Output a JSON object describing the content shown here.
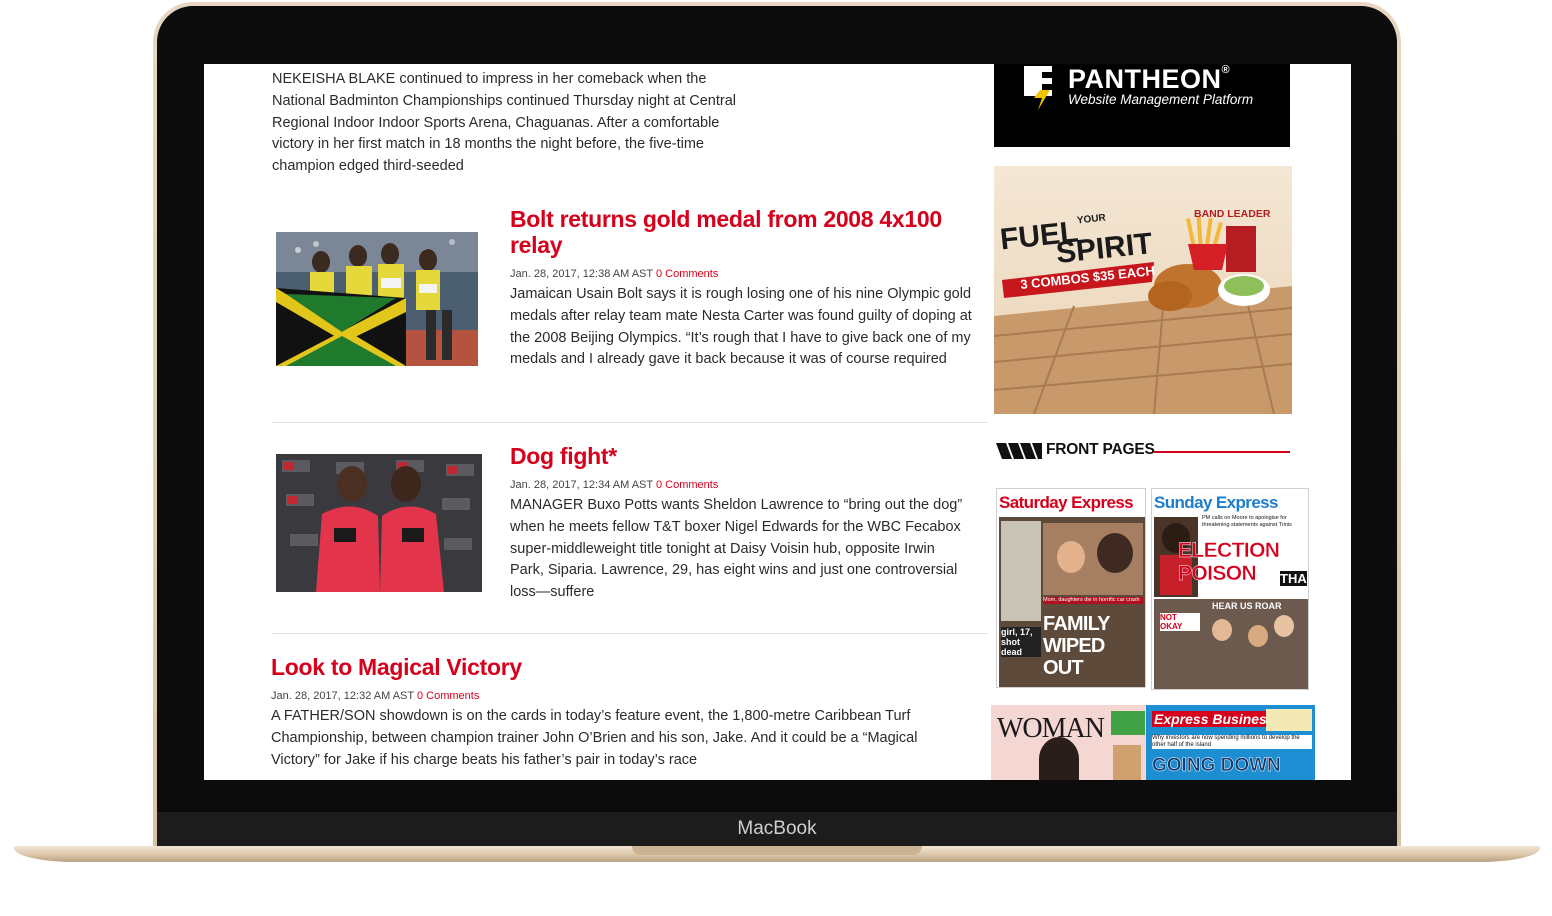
{
  "device": {
    "brand": "MacBook"
  },
  "lead_article": {
    "text": "NEKEISHA BLAKE continued to impress in her comeback when the National Badminton Championships continued Thursday night at Central Regional Indoor Indoor Sports Arena, Chaguanas. After a comfortable victory in her first match in 18 months the night before, the five-time champion edged third-seeded"
  },
  "articles": [
    {
      "headline": "Bolt returns gold medal from 2008 4x100 relay",
      "date": "Jan. 28, 2017, 12:38 AM AST",
      "comments": "0 Comments",
      "excerpt": "Jamaican Usain Bolt says it is rough losing one of his nine Olympic gold medals after relay team mate Nesta Carter was found guilty of doping at the 2008 Beijing Olympics. “It’s rough that I have to give back one of my medals and I already gave it back because it was of course required"
    },
    {
      "headline": "Dog fight*",
      "date": "Jan. 28, 2017, 12:34 AM AST",
      "comments": "0 Comments",
      "excerpt": "MANAGER Buxo Potts wants Sheldon Lawrence to “bring out the dog” when he meets fellow T&T boxer Nigel Edwards for the WBC Fecabox super-middleweight title tonight at Daisy Voisin hub, opposite Irwin Park, Siparia. Lawrence, 29, has eight wins and just one controversial loss—suffere"
    },
    {
      "headline": "Look to Magical Victory",
      "date": "Jan. 28, 2017, 12:32 AM AST",
      "comments": "0 Comments",
      "excerpt": "A FATHER/SON showdown is on the cards in today’s feature event, the 1,800-metre Caribbean Turf Championship, between champion trainer John O’Brien and his son, Jake. And it could be a “Magical Victory” for Jake if his charge beats his father’s pair in today’s race"
    }
  ],
  "sidebar": {
    "pantheon_ad": {
      "name": "PANTHEON",
      "reg": "®",
      "tagline": "Website Management Platform"
    },
    "food_ad": {
      "line1": "FUEL",
      "small": "YOUR",
      "line2": "SPIRIT",
      "offer": "3 COMBOS $35 EACH",
      "brand": "BAND LEADER"
    },
    "front_pages": {
      "title": "FRONT PAGES",
      "covers": [
        {
          "masthead": "Saturday Express",
          "headline": "FAMILY WIPED OUT",
          "sub": "Mom, daughters die in horrific car crash",
          "side": "girl, 17, shot dead"
        },
        {
          "masthead": "Sunday Express",
          "headline": "ELECTION POISON",
          "kicker": "THA",
          "sub": "PM calls on Moore to apologise for threatening statements against Trinis",
          "side": "HEAR US ROAR",
          "sign": "NOT OKAY"
        },
        {
          "masthead": "WOMAN"
        },
        {
          "masthead": "Express Business",
          "headline": "GOING DOWN",
          "sub": "Why investors are now spending millions to develop the other half of the island"
        }
      ]
    }
  },
  "colors": {
    "accent": "#d6001c",
    "text": "#2b2b2b",
    "rule": "#e2e2e2",
    "bezel": "#0c0c0c",
    "gold": "#d7c2a6"
  }
}
